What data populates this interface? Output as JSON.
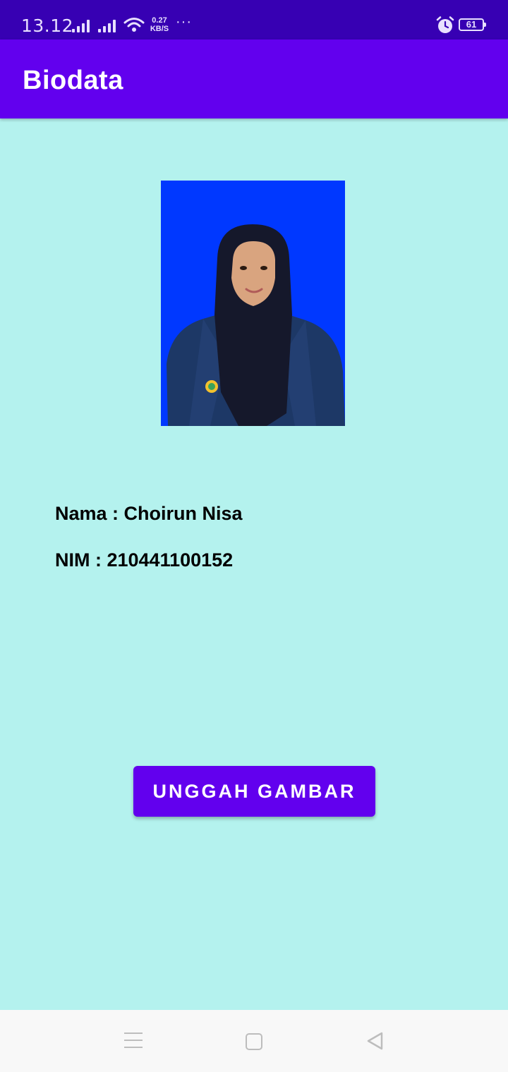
{
  "status_bar": {
    "time": "13.12",
    "net_speed_value": "0.27",
    "net_speed_unit": "KB/S",
    "more": "···",
    "battery_level": "61",
    "icons": [
      "signal-icon",
      "signal-icon",
      "wifi-icon",
      "alarm-icon",
      "battery-icon"
    ]
  },
  "app_bar": {
    "title": "Biodata",
    "color": "#6200ee"
  },
  "profile": {
    "photo_background": "#0038ff",
    "name_line": "Nama : Choirun Nisa",
    "nim_line": "NIM : 210441100152"
  },
  "actions": {
    "upload_label": "UNGGAH GAMBAR"
  },
  "nav_bar": {
    "icons": [
      "menu-icon",
      "home-icon",
      "back-icon"
    ]
  },
  "colors": {
    "status_bar": "#3700b3",
    "background": "#b4f2ee",
    "button": "#6200ee"
  }
}
